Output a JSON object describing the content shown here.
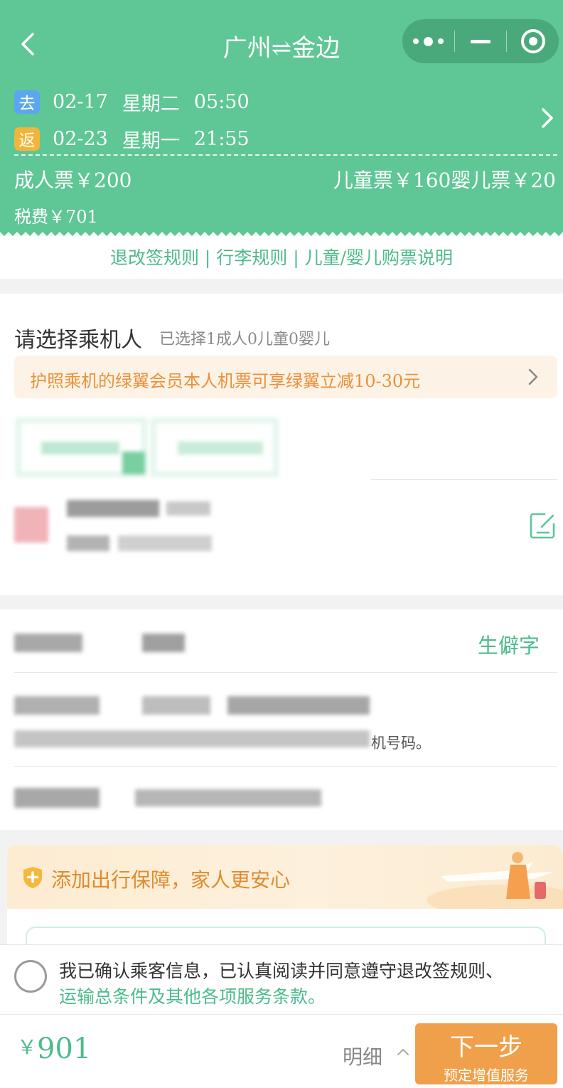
{
  "header": {
    "title": "广州⇌金边",
    "outbound": {
      "tag": "去",
      "date": "02-17",
      "weekday": "星期二",
      "time": "05:50"
    },
    "return": {
      "tag": "返",
      "date": "02-23",
      "weekday": "星期一",
      "time": "21:55"
    },
    "adult_price": "成人票￥200",
    "child_infant_price": "儿童票￥160婴儿票￥20",
    "tax": "税费￥701"
  },
  "rules_links": "退改签规则 | 行李规则 | 儿童/婴儿购票说明",
  "passenger": {
    "title": "请选择乘机人",
    "selected_summary": "已选择1成人0儿童0婴儿",
    "promo": "护照乘机的绿翼会员本人机票可享绿翼立减10-30元"
  },
  "contact": {
    "rare_char_link": "生僻字",
    "hint_tail": "机号码。"
  },
  "insurance": {
    "title": "添加出行保障，家人更安心"
  },
  "agreement": {
    "line1": "我已确认乘客信息，已认真阅读并同意遵守退改签规则、",
    "line2": "运输总条件及其他各项服务条款。"
  },
  "footer": {
    "currency": "￥",
    "total": "901",
    "detail_label": "明细",
    "next_label": "下一步",
    "next_sub": "预定增值服务"
  },
  "colors": {
    "brand_green": "#5fc695",
    "link_green": "#4dbb8a",
    "orange": "#f0a04b"
  }
}
